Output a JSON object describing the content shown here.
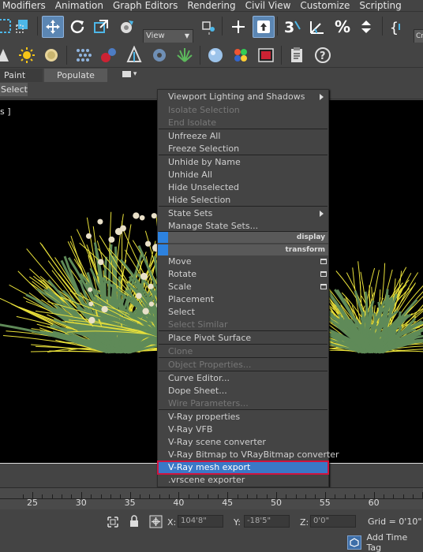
{
  "menubar": [
    "Modifiers",
    "Animation",
    "Graph Editors",
    "Rendering",
    "Civil View",
    "Customize",
    "Scripting"
  ],
  "toolbar": {
    "view_dropdown": "View",
    "right_dropdown": "Cr"
  },
  "tabs": {
    "paint": "Paint",
    "populate": "Populate"
  },
  "selection_box": "Selected",
  "viewport": {
    "label": "s ]"
  },
  "context_menu": {
    "items": [
      {
        "label": "Viewport Lighting and Shadows",
        "disabled": false,
        "submenu": true
      },
      {
        "label": "Isolate Selection",
        "disabled": true
      },
      {
        "label": "End Isolate",
        "disabled": true
      },
      {
        "label": "Unfreeze All",
        "disabled": false
      },
      {
        "label": "Freeze Selection",
        "disabled": false
      },
      {
        "label": "Unhide by Name",
        "disabled": false
      },
      {
        "label": "Unhide All",
        "disabled": false
      },
      {
        "label": "Hide Unselected",
        "disabled": false
      },
      {
        "label": "Hide Selection",
        "disabled": false
      },
      {
        "label": "State Sets",
        "disabled": false,
        "submenu": true
      },
      {
        "label": "Manage State Sets...",
        "disabled": false
      },
      {
        "label": "Move",
        "disabled": false,
        "options": true
      },
      {
        "label": "Rotate",
        "disabled": false,
        "options": true
      },
      {
        "label": "Scale",
        "disabled": false,
        "options": true
      },
      {
        "label": "Placement",
        "disabled": false
      },
      {
        "label": "Select",
        "disabled": false
      },
      {
        "label": "Select Similar",
        "disabled": true
      },
      {
        "label": "Place Pivot Surface",
        "disabled": false
      },
      {
        "label": "Clone",
        "disabled": true
      },
      {
        "label": "Object Properties...",
        "disabled": true
      },
      {
        "label": "Curve Editor...",
        "disabled": false
      },
      {
        "label": "Dope Sheet...",
        "disabled": false
      },
      {
        "label": "Wire Parameters...",
        "disabled": true
      },
      {
        "label": "V-Ray properties",
        "disabled": false
      },
      {
        "label": "V-Ray VFB",
        "disabled": false
      },
      {
        "label": "V-Ray scene converter",
        "disabled": false
      },
      {
        "label": "V-Ray Bitmap to VRayBitmap converter",
        "disabled": false
      },
      {
        "label": "V-Ray mesh export",
        "disabled": false,
        "highlighted": true
      },
      {
        "label": ".vrscene exporter",
        "disabled": false
      }
    ],
    "headers": {
      "display": "display",
      "transform": "transform"
    }
  },
  "timeline": {
    "labels": [
      "25",
      "30",
      "35",
      "40",
      "45",
      "50",
      "55",
      "60"
    ]
  },
  "status": {
    "x_label": "X:",
    "x_value": "104'8\"",
    "y_label": "Y:",
    "y_value": "-18'5\"",
    "z_label": "Z:",
    "z_value": "0'0\"",
    "grid": "Grid = 0'10\"",
    "add_time_tag": "Add Time Tag"
  },
  "colors": {
    "highlight": "#3a78c7",
    "highlight_outline": "#d0143f",
    "active_tool": "#5b86b3",
    "foliage_yellow": "#e8e03a",
    "foliage_green": "#5f8a58"
  }
}
